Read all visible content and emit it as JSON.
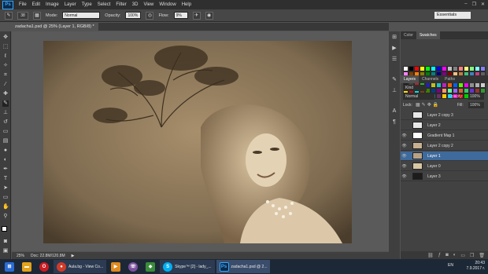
{
  "menubar": {
    "logo": "Ps",
    "items": [
      "File",
      "Edit",
      "Image",
      "Layer",
      "Type",
      "Select",
      "Filter",
      "3D",
      "View",
      "Window",
      "Help"
    ],
    "controls": [
      "–",
      "❐",
      "✕"
    ]
  },
  "options": {
    "mode_label": "Mode:",
    "mode_value": "Normal",
    "opacity_label": "Opacity:",
    "opacity_value": "100%",
    "flow_label": "Flow:",
    "flow_value": "9%",
    "workspace": "Essentials",
    "brush_size": "38"
  },
  "document": {
    "tab_title": "zadacha1.psd @ 25% (Layer 1, RGB/8) *"
  },
  "status": {
    "zoom": "25%",
    "doc_size": "Doc: 22.8M/120.8M"
  },
  "panels": {
    "tabs_top": [
      "Color",
      "Swatches"
    ],
    "tabs_layers": [
      "Layers",
      "Channels",
      "Paths"
    ],
    "kind": "Kind",
    "blend": "Normal",
    "opacity_label": "Opacity:",
    "opacity_value": "100%",
    "lock_label": "Lock:",
    "fill_label": "Fill:",
    "fill_value": "100%",
    "layers": [
      {
        "name": "Layer 2 copy 3",
        "visible": false
      },
      {
        "name": "Layer 2",
        "visible": false
      },
      {
        "name": "Gradient Map 1",
        "visible": true
      },
      {
        "name": "Layer 2 copy 2",
        "visible": true
      },
      {
        "name": "Layer 1",
        "visible": true,
        "selected": true
      },
      {
        "name": "Layer 0",
        "visible": true
      },
      {
        "name": "Layer 3",
        "visible": true
      }
    ]
  },
  "swatch_colors": [
    "#ffffff",
    "#000000",
    "#ff0000",
    "#ffff00",
    "#00ff00",
    "#00ffff",
    "#0000ff",
    "#ff00ff",
    "#c0c0c0",
    "#808080",
    "#ff8080",
    "#ffff80",
    "#80ff80",
    "#80ffff",
    "#8080ff",
    "#ff80ff",
    "#804000",
    "#ff8000",
    "#808000",
    "#008000",
    "#008080",
    "#000080",
    "#800080",
    "#800000",
    "#ffc080",
    "#c08040",
    "#40c080",
    "#4080c0",
    "#c04080",
    "#606060",
    "#e0b090",
    "#b07040",
    "#60a040",
    "#3060a0",
    "#a03060",
    "#f0e0c0",
    "#d0a060",
    "#a0d060",
    "#60a0d0",
    "#d060a0",
    "#402010",
    "#604020",
    "#806040",
    "#a08060",
    "#c0a080",
    "#202020",
    "#404040",
    "#c02020",
    "#20c020",
    "#2020c0",
    "#c0c020",
    "#20c0c0",
    "#c020c0",
    "#f06000",
    "#0060f0",
    "#60f000",
    "#f000f0",
    "#909090",
    "#b0b0b0",
    "#d0d0d0",
    "#ffe000",
    "#e00000",
    "#00e0e0",
    "#7f3f00",
    "#3f7f00",
    "#003f7f",
    "#7f007f",
    "#ff9966",
    "#66ff99",
    "#9966ff",
    "#cc6633",
    "#33cc66",
    "#6633cc",
    "#993333",
    "#339933",
    "#333399",
    "#cccc99",
    "#99cccc",
    "#cc99cc",
    "#666633",
    "#336666",
    "#663366",
    "#ffcc00",
    "#00ccff",
    "#ff00cc",
    "#cc0000",
    "#00cc00",
    "#0000cc",
    "#777777"
  ],
  "taskbar": {
    "apps": [
      {
        "label": "Aula.bg - View Co...",
        "icon": "chrome-icon",
        "color": "#d03b2a"
      },
      {
        "label": "Skype™ [2] - lady_...",
        "icon": "skype-icon",
        "color": "#00aff0"
      },
      {
        "label": "zadacha1.psd @ 2...",
        "icon": "photoshop-icon",
        "color": "#0d2a4a"
      }
    ],
    "lang": "EN",
    "time": "20:43",
    "date": "7.9.2017 г."
  }
}
